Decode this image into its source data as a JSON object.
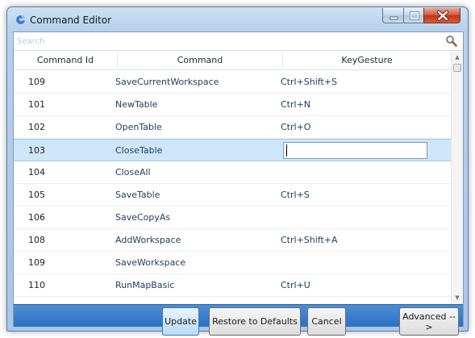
{
  "window": {
    "title": "Command Editor"
  },
  "search": {
    "placeholder": "Search"
  },
  "grid": {
    "columns": [
      "Command Id",
      "Command",
      "KeyGesture"
    ],
    "rows": [
      {
        "id": "109",
        "command": "SaveCurrentWorkspace",
        "gesture": "Ctrl+Shift+S"
      },
      {
        "id": "101",
        "command": "NewTable",
        "gesture": "Ctrl+N"
      },
      {
        "id": "102",
        "command": "OpenTable",
        "gesture": "Ctrl+O"
      },
      {
        "id": "103",
        "command": "CloseTable",
        "gesture": ""
      },
      {
        "id": "104",
        "command": "CloseAll",
        "gesture": ""
      },
      {
        "id": "105",
        "command": "SaveTable",
        "gesture": "Ctrl+S"
      },
      {
        "id": "106",
        "command": "SaveCopyAs",
        "gesture": ""
      },
      {
        "id": "108",
        "command": "AddWorkspace",
        "gesture": "Ctrl+Shift+A"
      },
      {
        "id": "109",
        "command": "SaveWorkspace",
        "gesture": ""
      },
      {
        "id": "110",
        "command": "RunMapBasic",
        "gesture": "Ctrl+U"
      }
    ],
    "selected_row": 3
  },
  "buttons": {
    "update": "Update",
    "restore": "Restore to Defaults",
    "cancel": "Cancel",
    "advanced": "Advanced -->"
  },
  "icons": {
    "app": "app-icon",
    "search": "search-icon",
    "minimize": "minimize-icon",
    "maximize": "maximize-icon",
    "close": "close-icon"
  },
  "colors": {
    "footer": "#3a7fcc",
    "selection": "#cfe6f8",
    "link_text": "#1c3f66",
    "close_button": "#c8452a"
  }
}
